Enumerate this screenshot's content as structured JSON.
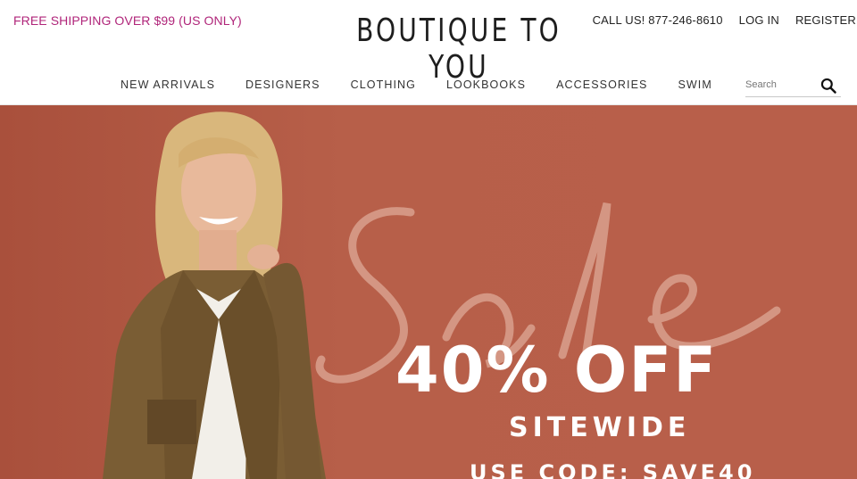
{
  "promo": {
    "text": "FREE SHIPPING OVER $99 (US ONLY)"
  },
  "brand": {
    "logo": "BOUTIQUE TO YOU"
  },
  "utility": {
    "call": "CALL US! 877-246-8610",
    "login": "LOG IN",
    "register": "REGISTER"
  },
  "nav": {
    "items": [
      "NEW ARRIVALS",
      "DESIGNERS",
      "CLOTHING",
      "LOOKBOOKS",
      "ACCESSORIES",
      "SWIM"
    ]
  },
  "search": {
    "placeholder": "Search",
    "icon": "search-icon"
  },
  "hero": {
    "script_text": "Sale",
    "headline": "40% OFF",
    "subline": "SITEWIDE",
    "code": "USE CODE: SAVE40"
  },
  "colors": {
    "promo": "#b0257a",
    "hero_bg": "#b55c47"
  }
}
